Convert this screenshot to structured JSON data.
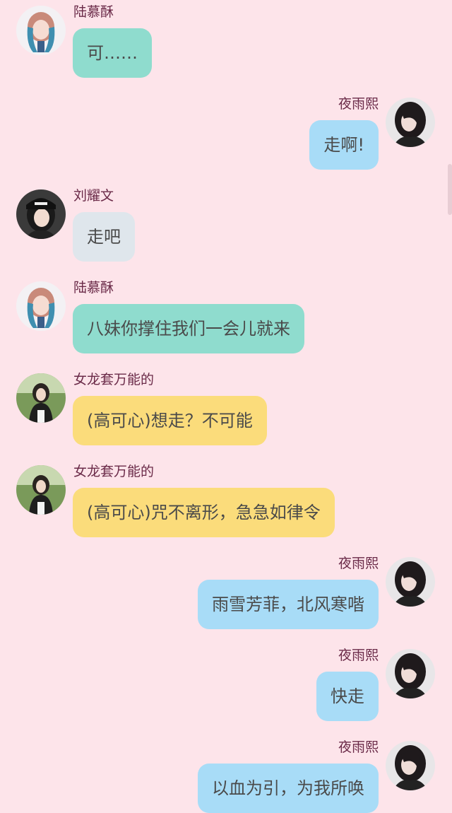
{
  "colors": {
    "background": "#fde4ea",
    "name_text": "#6a2a48",
    "message_text": "#4a4a4a"
  },
  "messages": [
    {
      "side": "left",
      "sender": "陆慕酥",
      "text": "可……",
      "bubble_color": "#8fdcce",
      "avatar": "blue-hair-girl-avatar"
    },
    {
      "side": "right",
      "sender": "夜雨熙",
      "text": "走啊!",
      "bubble_color": "#a8dcf7",
      "avatar": "dark-hair-girl-avatar"
    },
    {
      "side": "left",
      "sender": "刘耀文",
      "text": "走吧",
      "bubble_color": "#dfe6ec",
      "avatar": "cap-girl-avatar"
    },
    {
      "side": "left",
      "sender": "陆慕酥",
      "text": "八妹你撑住我们一会儿就来",
      "bubble_color": "#8fdcce",
      "avatar": "blue-hair-girl-avatar"
    },
    {
      "side": "left",
      "sender": "女龙套万能的",
      "text": "(高可心)想走？不可能",
      "bubble_color": "#fbdc7b",
      "avatar": "outdoor-girl-avatar"
    },
    {
      "side": "left",
      "sender": "女龙套万能的",
      "text": "(高可心)咒不离形，急急如律令",
      "bubble_color": "#fbdc7b",
      "avatar": "outdoor-girl-avatar"
    },
    {
      "side": "right",
      "sender": "夜雨熙",
      "text": "雨雪芳菲，北风寒喈",
      "bubble_color": "#a8dcf7",
      "avatar": "dark-hair-girl-avatar"
    },
    {
      "side": "right",
      "sender": "夜雨熙",
      "text": "快走",
      "bubble_color": "#a8dcf7",
      "avatar": "dark-hair-girl-avatar"
    },
    {
      "side": "right",
      "sender": "夜雨熙",
      "text": "以血为引，为我所唤",
      "bubble_color": "#a8dcf7",
      "avatar": "dark-hair-girl-avatar"
    }
  ]
}
